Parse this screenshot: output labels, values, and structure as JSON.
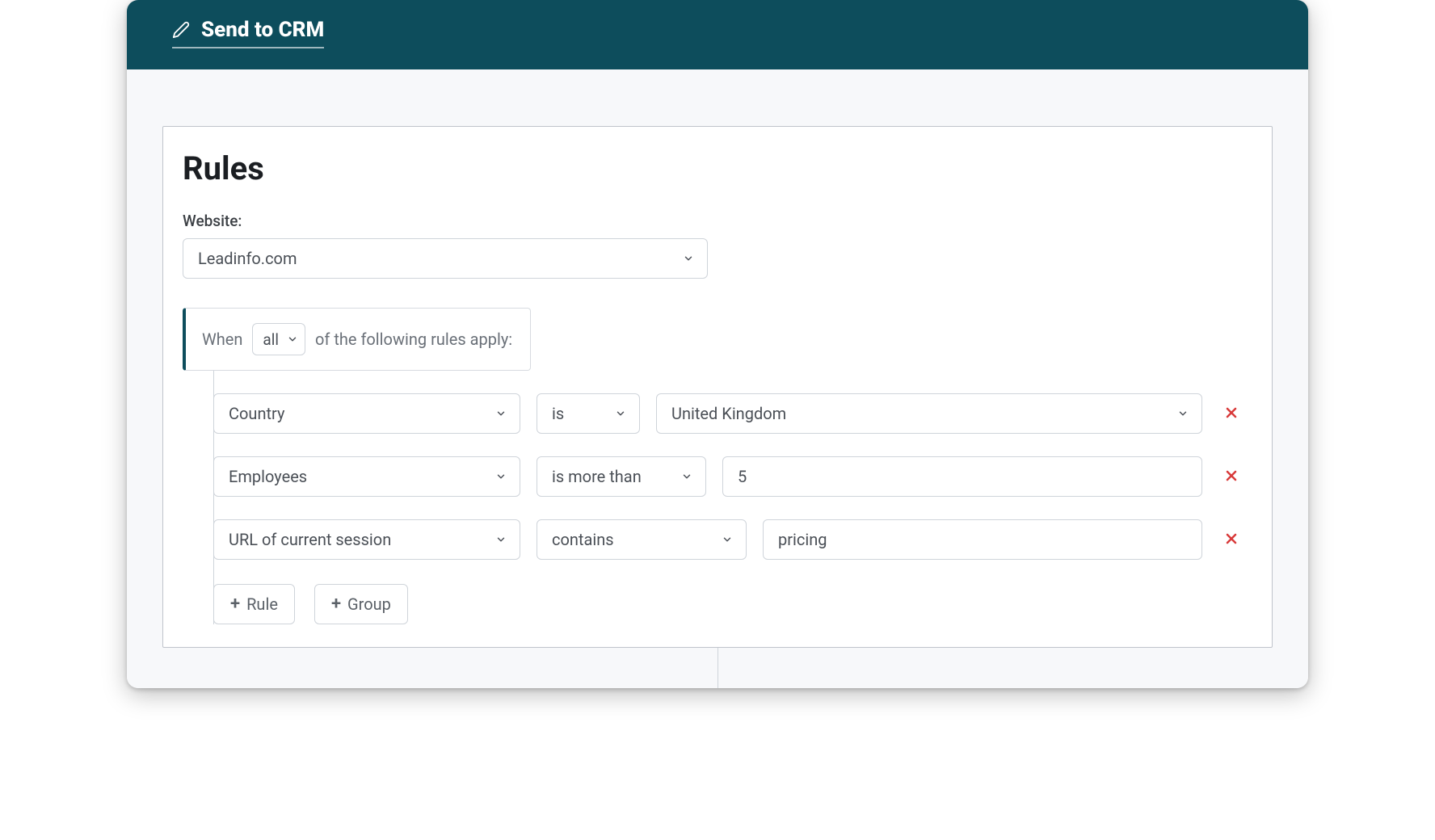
{
  "header": {
    "title": "Send to CRM"
  },
  "rules": {
    "heading": "Rules",
    "website_label": "Website:",
    "website_value": "Leadinfo.com",
    "when_prefix": "When",
    "when_match": "all",
    "when_suffix": "of the following rules apply:",
    "rows": [
      {
        "field": "Country",
        "operator": "is",
        "value": "United Kingdom",
        "value_type": "select"
      },
      {
        "field": "Employees",
        "operator": "is more than",
        "value": "5",
        "value_type": "input"
      },
      {
        "field": "URL of current session",
        "operator": "contains",
        "value": "pricing",
        "value_type": "input"
      }
    ],
    "add_rule_label": "Rule",
    "add_group_label": "Group"
  },
  "colors": {
    "header_bg": "#0d4d5c",
    "danger": "#d83a3a"
  }
}
